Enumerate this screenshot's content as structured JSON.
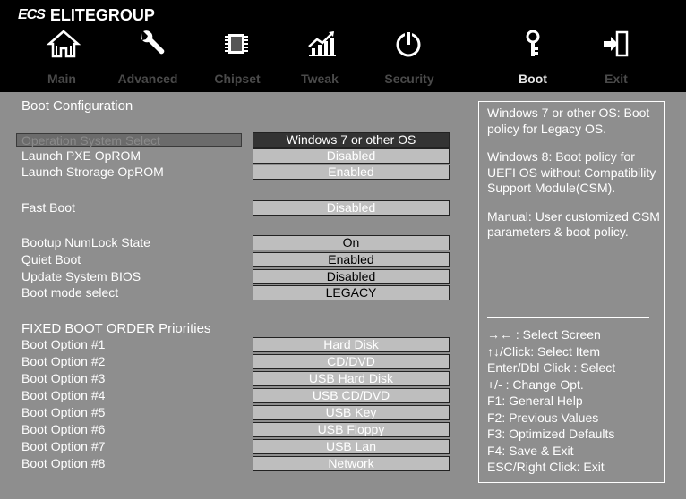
{
  "brand": {
    "logo_text": "ECS",
    "name": "ELITEGROUP"
  },
  "colors": {
    "header": "#000000",
    "panel": "#8e8e8e",
    "selected_value_bg": "#333333",
    "value_box": "#bebebe",
    "text": "#ffffff"
  },
  "icons": [
    "home-icon",
    "wrench-icon",
    "chip-icon",
    "chart-icon",
    "power-icon",
    "key-icon",
    "exit-icon"
  ],
  "tabs": [
    {
      "label": "Main"
    },
    {
      "label": "Advanced"
    },
    {
      "label": "Chipset"
    },
    {
      "label": "Tweak"
    },
    {
      "label": "Security"
    },
    {
      "label": "Boot",
      "active": true
    },
    {
      "label": "Exit"
    }
  ],
  "section": {
    "title": "Boot Configuration",
    "fixed_order_title": "FIXED BOOT ORDER Priorities"
  },
  "settings": {
    "os_select": {
      "label": "Operation System Select",
      "value": "Windows 7 or other OS"
    },
    "pxe": {
      "label": "Launch PXE OpROM",
      "value": "Disabled"
    },
    "storage": {
      "label": "Launch Strorage OpROM",
      "value": "Enabled"
    },
    "fast_boot": {
      "label": "Fast Boot",
      "value": "Disabled"
    },
    "numlock": {
      "label": "Bootup NumLock State",
      "value": "On"
    },
    "quiet": {
      "label": "Quiet Boot",
      "value": "Enabled"
    },
    "update_bios": {
      "label": "Update System BIOS",
      "value": "Disabled"
    },
    "boot_mode": {
      "label": "Boot mode select",
      "value": "LEGACY"
    }
  },
  "boot_options": [
    {
      "label": "Boot Option #1",
      "value": "Hard Disk"
    },
    {
      "label": "Boot Option #2",
      "value": "CD/DVD"
    },
    {
      "label": "Boot Option #3",
      "value": "USB Hard Disk"
    },
    {
      "label": "Boot Option #4",
      "value": "USB CD/DVD"
    },
    {
      "label": "Boot Option #5",
      "value": "USB Key"
    },
    {
      "label": "Boot Option #6",
      "value": "USB Floppy"
    },
    {
      "label": "Boot Option #7",
      "value": "USB Lan"
    },
    {
      "label": "Boot Option #8",
      "value": "Network"
    }
  ],
  "help": {
    "paragraphs": [
      "Windows 7 or other OS: Boot policy for Legacy OS.",
      "Windows 8: Boot policy for UEFI OS without Compatibility Support Module(CSM).",
      "Manual: User customized CSM parameters & boot policy."
    ],
    "keys": [
      "→←  : Select Screen",
      "↑↓/Click: Select Item",
      "Enter/Dbl Click : Select",
      "+/- : Change Opt.",
      "F1: General Help",
      "F2: Previous Values",
      "F3: Optimized Defaults",
      "F4: Save & Exit",
      "ESC/Right Click: Exit"
    ]
  }
}
